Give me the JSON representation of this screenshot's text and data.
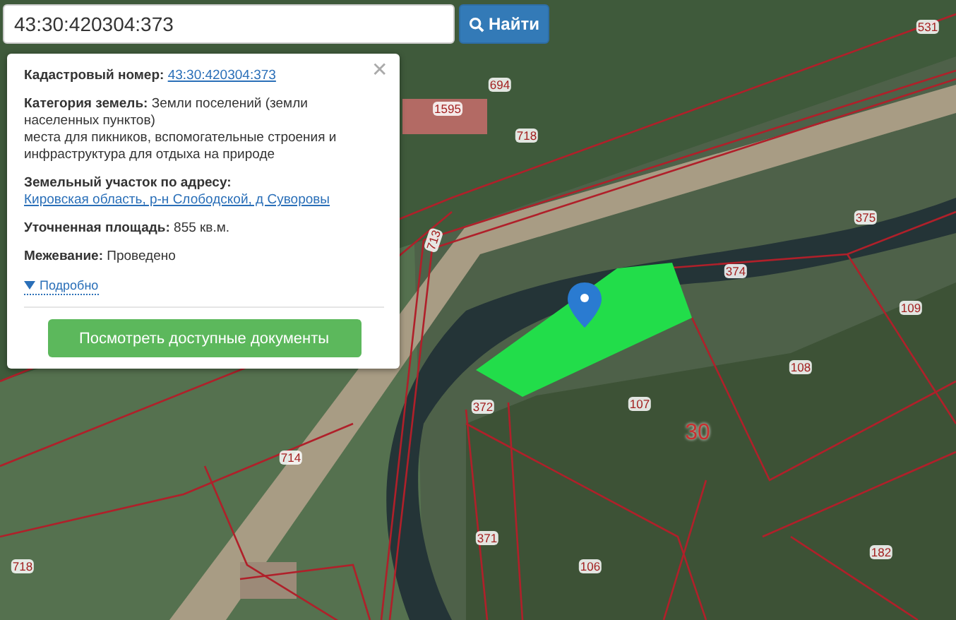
{
  "search": {
    "value": "43:30:420304:373",
    "button": "Найти"
  },
  "popup": {
    "fields": [
      {
        "label": "Кадастровый номер:",
        "value": "43:30:420304:373",
        "kind": "link"
      },
      {
        "label": "Категория земель:",
        "value": "Земли поселений (земли населенных пунктов)",
        "extra": "места для пикников, вспомогательные строения и инфраструктура для отдыха на природе",
        "kind": "text"
      },
      {
        "label": "Земельный участок по адресу:",
        "value": "Кировская область, р-н Слободской, д Суворовы",
        "kind": "link"
      },
      {
        "label": "Уточненная площадь:",
        "value": "855 кв.м.",
        "kind": "text"
      },
      {
        "label": "Межевание:",
        "value": "Проведено",
        "kind": "text"
      }
    ],
    "close": "✕",
    "details": "Подробно",
    "expanded": false,
    "button": "Посмотреть доступные документы"
  },
  "parcels": [
    "531",
    "694",
    "1595",
    "718",
    "713",
    "375",
    "374",
    "109",
    "108",
    "107",
    "30",
    "372",
    "371",
    "106",
    "182",
    "714",
    "718"
  ]
}
